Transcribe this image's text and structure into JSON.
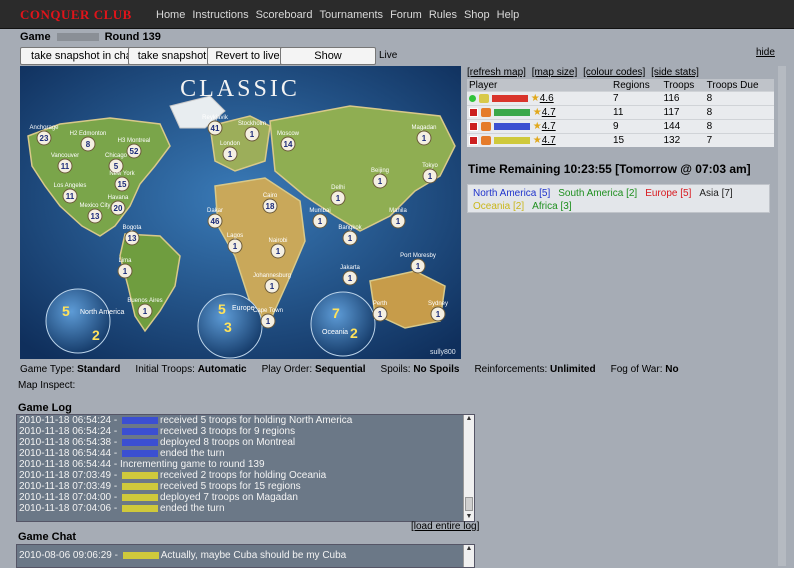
{
  "site": {
    "logo": "CONQUER CLUB"
  },
  "nav": [
    "Home",
    "Instructions",
    "Scoreboard",
    "Tournaments",
    "Forum",
    "Rules",
    "Shop",
    "Help"
  ],
  "game": {
    "label": "Game",
    "round": "Round 139"
  },
  "buttons": {
    "snapshot_chat": "take snapshot in chat",
    "snapshot": "take snapshot",
    "revert": "Revert to live",
    "differences": "Show differences"
  },
  "live_label": "Live",
  "hide_label": "hide",
  "map": {
    "title": "CLASSIC",
    "credit": "sully800",
    "labels": [
      {
        "name": "Anchorage",
        "num": "23"
      },
      {
        "name": "H2 Edmonton",
        "num": "8"
      },
      {
        "name": "H3 Montreal",
        "num": "52"
      },
      {
        "name": "Vancouver",
        "num": "11"
      },
      {
        "name": "Chicago",
        "num": "5"
      },
      {
        "name": "New York",
        "num": "15"
      },
      {
        "name": "Los Angeles",
        "num": "11"
      },
      {
        "name": "Mexico City",
        "num": "13"
      },
      {
        "name": "Havana",
        "num": "20"
      },
      {
        "name": "Bogota",
        "num": "13"
      },
      {
        "name": "Lima",
        "num": "1"
      },
      {
        "name": "Buenos Aires",
        "num": "1"
      },
      {
        "name": "Reykjavik",
        "num": "41"
      },
      {
        "name": "Stockholm",
        "num": "1"
      },
      {
        "name": "Moscow",
        "num": "14"
      },
      {
        "name": "London",
        "num": "1"
      },
      {
        "name": "Dakar",
        "num": "46"
      },
      {
        "name": "Lagos",
        "num": "1"
      },
      {
        "name": "Cairo",
        "num": "18"
      },
      {
        "name": "Nairobi",
        "num": "1"
      },
      {
        "name": "Johannesburg",
        "num": "1"
      },
      {
        "name": "Cape Town",
        "num": "1"
      },
      {
        "name": "Magadan",
        "num": "1"
      },
      {
        "name": "Tokyo",
        "num": "1"
      },
      {
        "name": "Beijing",
        "num": "1"
      },
      {
        "name": "Manila",
        "num": "1"
      },
      {
        "name": "Bangkok",
        "num": "1"
      },
      {
        "name": "Jakarta",
        "num": "1"
      },
      {
        "name": "Port Moresby",
        "num": "1"
      },
      {
        "name": "Perth",
        "num": "1"
      },
      {
        "name": "Sydney",
        "num": "1"
      },
      {
        "name": "Mumbai",
        "num": "1"
      },
      {
        "name": "Delhi",
        "num": "1"
      }
    ],
    "globes": [
      {
        "name": "North America",
        "n1": "5",
        "n2": "2"
      },
      {
        "name": "Europe",
        "n1": "5",
        "n2": "3"
      },
      {
        "name": "Oceania",
        "n1": "7",
        "n2": "2"
      }
    ]
  },
  "links": [
    "[refresh map]",
    "[map size]",
    "[colour codes]",
    "[side stats]"
  ],
  "players_table": {
    "headers": [
      "Player",
      "Regions",
      "Troops",
      "Troops Due"
    ],
    "rows": [
      {
        "rating": "4.6",
        "regions": "7",
        "troops": "116",
        "due": "8",
        "color": "#d9342b",
        "icon": "#d8c94a"
      },
      {
        "rating": "4.7",
        "regions": "11",
        "troops": "117",
        "due": "8",
        "color": "#3ba84a",
        "icon": "#e57b2a"
      },
      {
        "rating": "4.7",
        "regions": "9",
        "troops": "144",
        "due": "8",
        "color": "#3b4fd1",
        "icon": "#e57b2a"
      },
      {
        "rating": "4.7",
        "regions": "15",
        "troops": "132",
        "due": "7",
        "color": "#cfc93b",
        "icon": "#e57b2a"
      }
    ]
  },
  "timer": "Time Remaining 10:23:55 [Tomorrow @ 07:03 am]",
  "bonuses": [
    {
      "text": "North America [5]",
      "color": "#1f33cc"
    },
    {
      "text": "South America [2]",
      "color": "#1e8f1e"
    },
    {
      "text": "Europe [5]",
      "color": "#d8191f"
    },
    {
      "text": "Asia [7]",
      "color": "#222222"
    },
    {
      "text": "Oceania [2]",
      "color": "#c9b61a"
    },
    {
      "text": "Africa [3]",
      "color": "#1e8f1e"
    }
  ],
  "settings": [
    {
      "label": "Game Type:",
      "value": "Standard"
    },
    {
      "label": "Initial Troops:",
      "value": "Automatic"
    },
    {
      "label": "Play Order:",
      "value": "Sequential"
    },
    {
      "label": "Spoils:",
      "value": "No Spoils"
    },
    {
      "label": "Reinforcements:",
      "value": "Unlimited"
    },
    {
      "label": "Fog of War:",
      "value": "No"
    }
  ],
  "map_inspect": "Map Inspect:",
  "game_log": {
    "title": "Game Log",
    "lines": [
      {
        "time": "2010-11-18 06:54:24 -",
        "tag": "#3b4fd1",
        "text": "received 5 troops for holding North America"
      },
      {
        "time": "2010-11-18 06:54:24 -",
        "tag": "#3b4fd1",
        "text": "received 3 troops for 9 regions"
      },
      {
        "time": "2010-11-18 06:54:38 -",
        "tag": "#3b4fd1",
        "text": "deployed 8 troops on Montreal"
      },
      {
        "time": "2010-11-18 06:54:44 -",
        "tag": "#3b4fd1",
        "text": "ended the turn"
      },
      {
        "time": "2010-11-18 06:54:44 -",
        "tag": "",
        "text": "Incrementing game to round 139"
      },
      {
        "time": "2010-11-18 07:03:49 -",
        "tag": "#cfc93b",
        "text": "received 2 troops for holding Oceania"
      },
      {
        "time": "2010-11-18 07:03:49 -",
        "tag": "#cfc93b",
        "text": "received 5 troops for 15 regions"
      },
      {
        "time": "2010-11-18 07:04:00 -",
        "tag": "#cfc93b",
        "text": "deployed 7 troops on Magadan"
      },
      {
        "time": "2010-11-18 07:04:06 -",
        "tag": "#cfc93b",
        "text": "ended the turn"
      }
    ],
    "load_label": "[load entire log]"
  },
  "game_chat": {
    "title": "Game Chat",
    "lines": [
      {
        "time": "2010-08-06 09:06:29 -",
        "tag": "#cfc93b",
        "text": "Actually, maybe Cuba should be my Cuba"
      }
    ]
  }
}
